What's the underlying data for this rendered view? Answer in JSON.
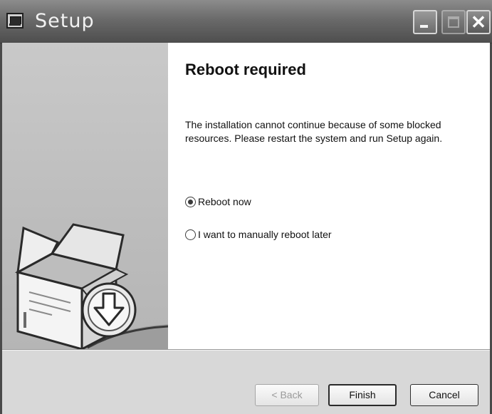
{
  "window": {
    "title": "Setup",
    "controls": {
      "minimize_icon": "minimize-icon",
      "maximize_icon": "maximize-icon",
      "close_icon": "close-icon",
      "close_glyph": "✕"
    }
  },
  "banner": {
    "illustration_icon": "install-box-download-icon"
  },
  "content": {
    "heading": "Reboot required",
    "message": "The installation cannot continue because of some blocked resources. Please restart the system and run Setup again.",
    "options": [
      {
        "label": "Reboot now",
        "selected": true
      },
      {
        "label": "I want to manually reboot later",
        "selected": false
      }
    ]
  },
  "footer": {
    "back_label": "< Back",
    "finish_label": "Finish",
    "cancel_label": "Cancel",
    "back_enabled": false
  }
}
